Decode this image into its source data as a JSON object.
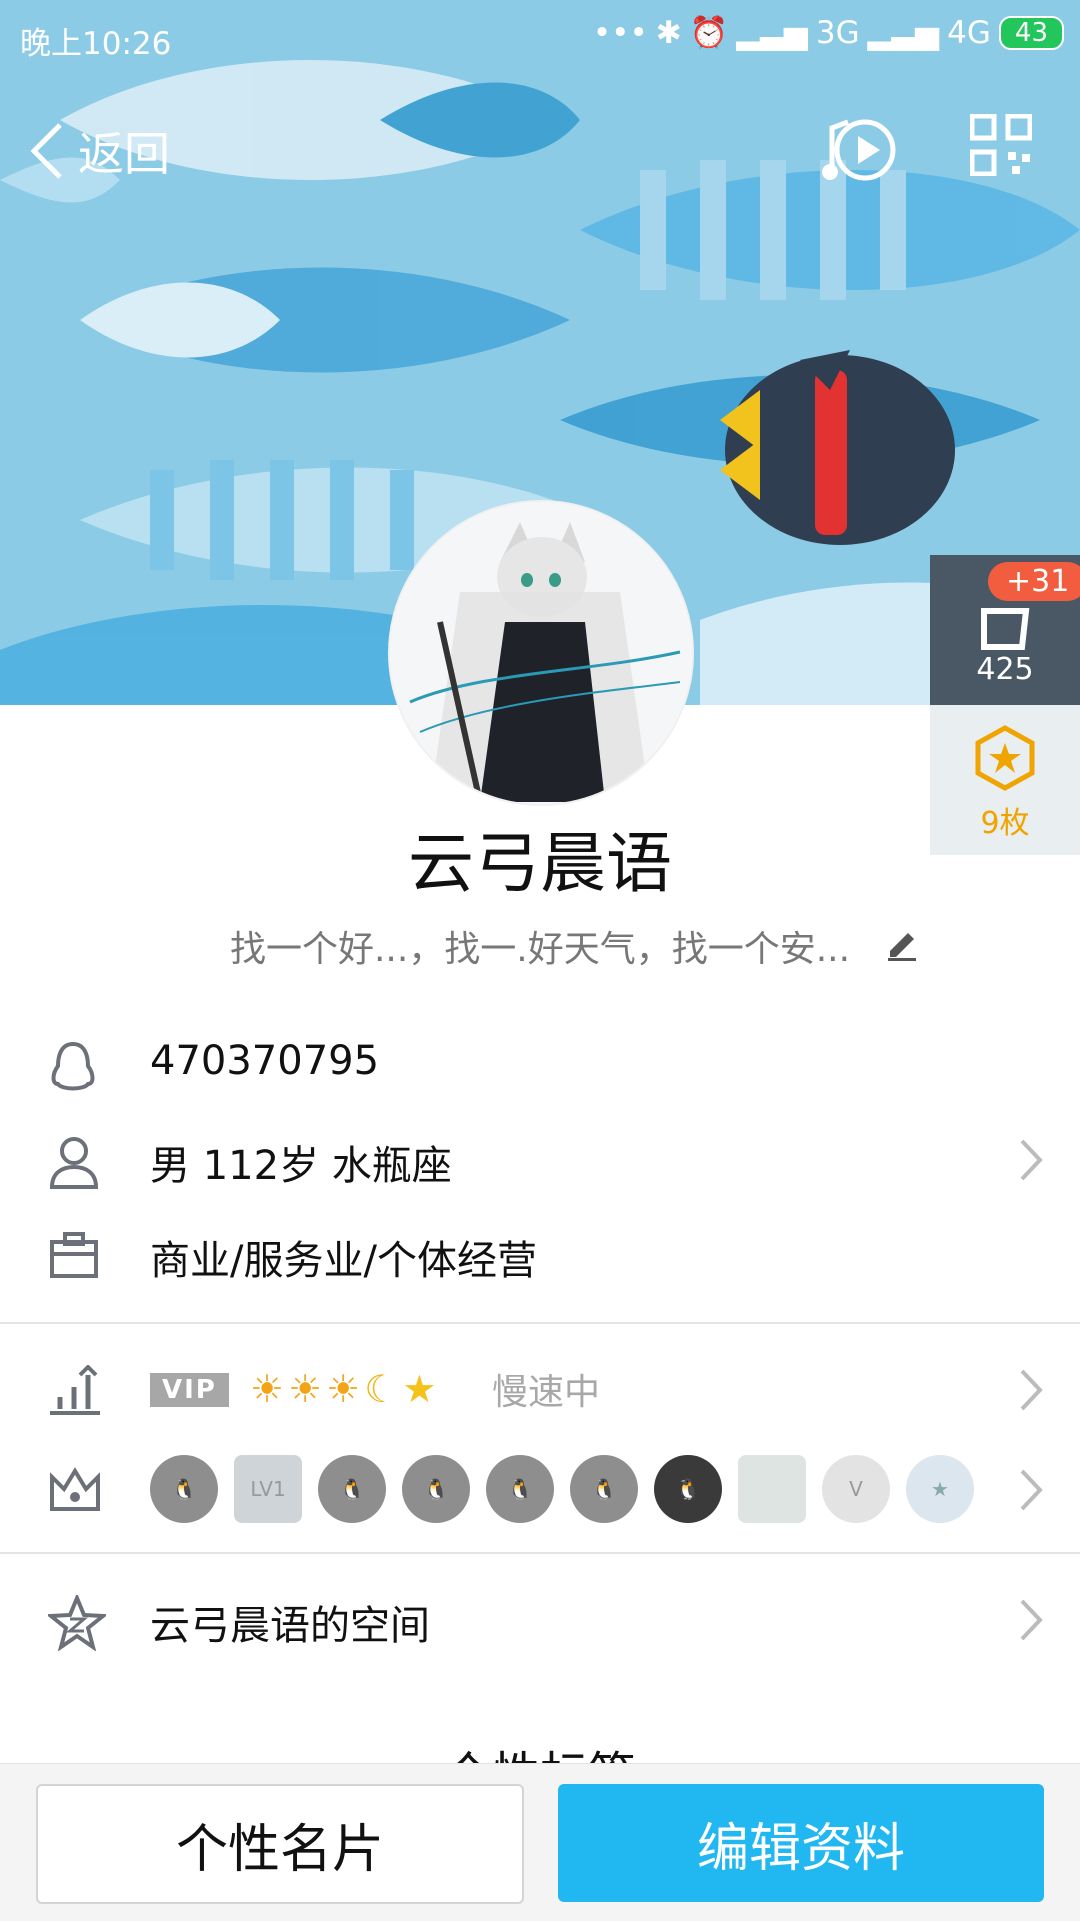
{
  "status_bar": {
    "time": "晚上10:26",
    "network_3g": "3G",
    "network_4g": "4G",
    "battery": "43"
  },
  "nav": {
    "back_label": "返回"
  },
  "side": {
    "visitor_badge": "+31",
    "visitor_count": "425",
    "medal_count": "9枚"
  },
  "profile": {
    "name": "云弓晨语",
    "signature": "找一个好...，找一.好天气，找一个安..."
  },
  "info": {
    "qq_number": "470370795",
    "basic": "男  112岁  水瓶座",
    "occupation": "商业/服务业/个体经营"
  },
  "level": {
    "vip_tag": "VIP",
    "speed": "慢速中",
    "icons": [
      "sun",
      "sun",
      "sun",
      "moon",
      "star"
    ]
  },
  "badges": {
    "lv_label": "LV1"
  },
  "space": {
    "label": "云弓晨语的空间"
  },
  "tags_title_peek": "· 个性标签 ·",
  "buttons": {
    "card": "个性名片",
    "edit": "编辑资料"
  },
  "colors": {
    "accent": "#21b7f0",
    "badge_red": "#f25c3f",
    "medal_gold": "#f0a400"
  }
}
